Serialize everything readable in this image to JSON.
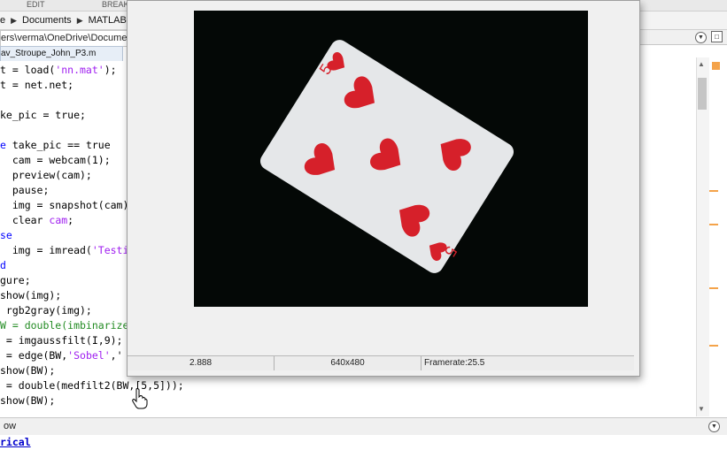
{
  "toolbar": {
    "edit_label": "EDIT",
    "breakpoints_label": "BREAK"
  },
  "breadcrumb": {
    "items": [
      "e",
      "Documents",
      "MATLAB"
    ]
  },
  "path": {
    "value": "ers\\verma\\OneDrive\\Documen"
  },
  "editor_tab": {
    "label": "av_Stroupe_John_P3.m"
  },
  "code": {
    "l1a": "t = load(",
    "l1b": "'nn.mat'",
    "l1c": ");",
    "l2": "t = net.net;",
    "l3": "ke_pic = true;",
    "l4": " take_pic == true",
    "l5": "  cam = webcam(1);",
    "l6": "  preview(cam);",
    "l7": "  pause;",
    "l8": "  img = snapshot(cam)",
    "l9a": "  clear ",
    "l9b": "cam",
    "l10": "se",
    "l11a": "  img = imread(",
    "l11b": "'Testi",
    "l12": "d",
    "l13": "gure;",
    "l14": "show(img);",
    "l15": " rgb2gray(img);",
    "l16": "W = double(imbinarize",
    "l17": " = imgaussfilt(I,9);",
    "l18a": " = edge(BW,",
    "l18b": "'Sobel'",
    "l18c": ",'",
    "l19": "show(BW);",
    "l20": " = double(medfilt2(BW,[5,5]));",
    "l21": "show(BW);"
  },
  "command_window": {
    "title": "ow",
    "link_text": "rical"
  },
  "preview": {
    "status_left": "2.888",
    "resolution": "640x480",
    "framerate": "Framerate:25.5"
  },
  "card": {
    "rank": "5",
    "suit_color": "#d6202a"
  },
  "icons": [
    "chevron-right-icon",
    "dropdown-circle-icon",
    "maximize-icon",
    "hand-cursor-icon"
  ]
}
